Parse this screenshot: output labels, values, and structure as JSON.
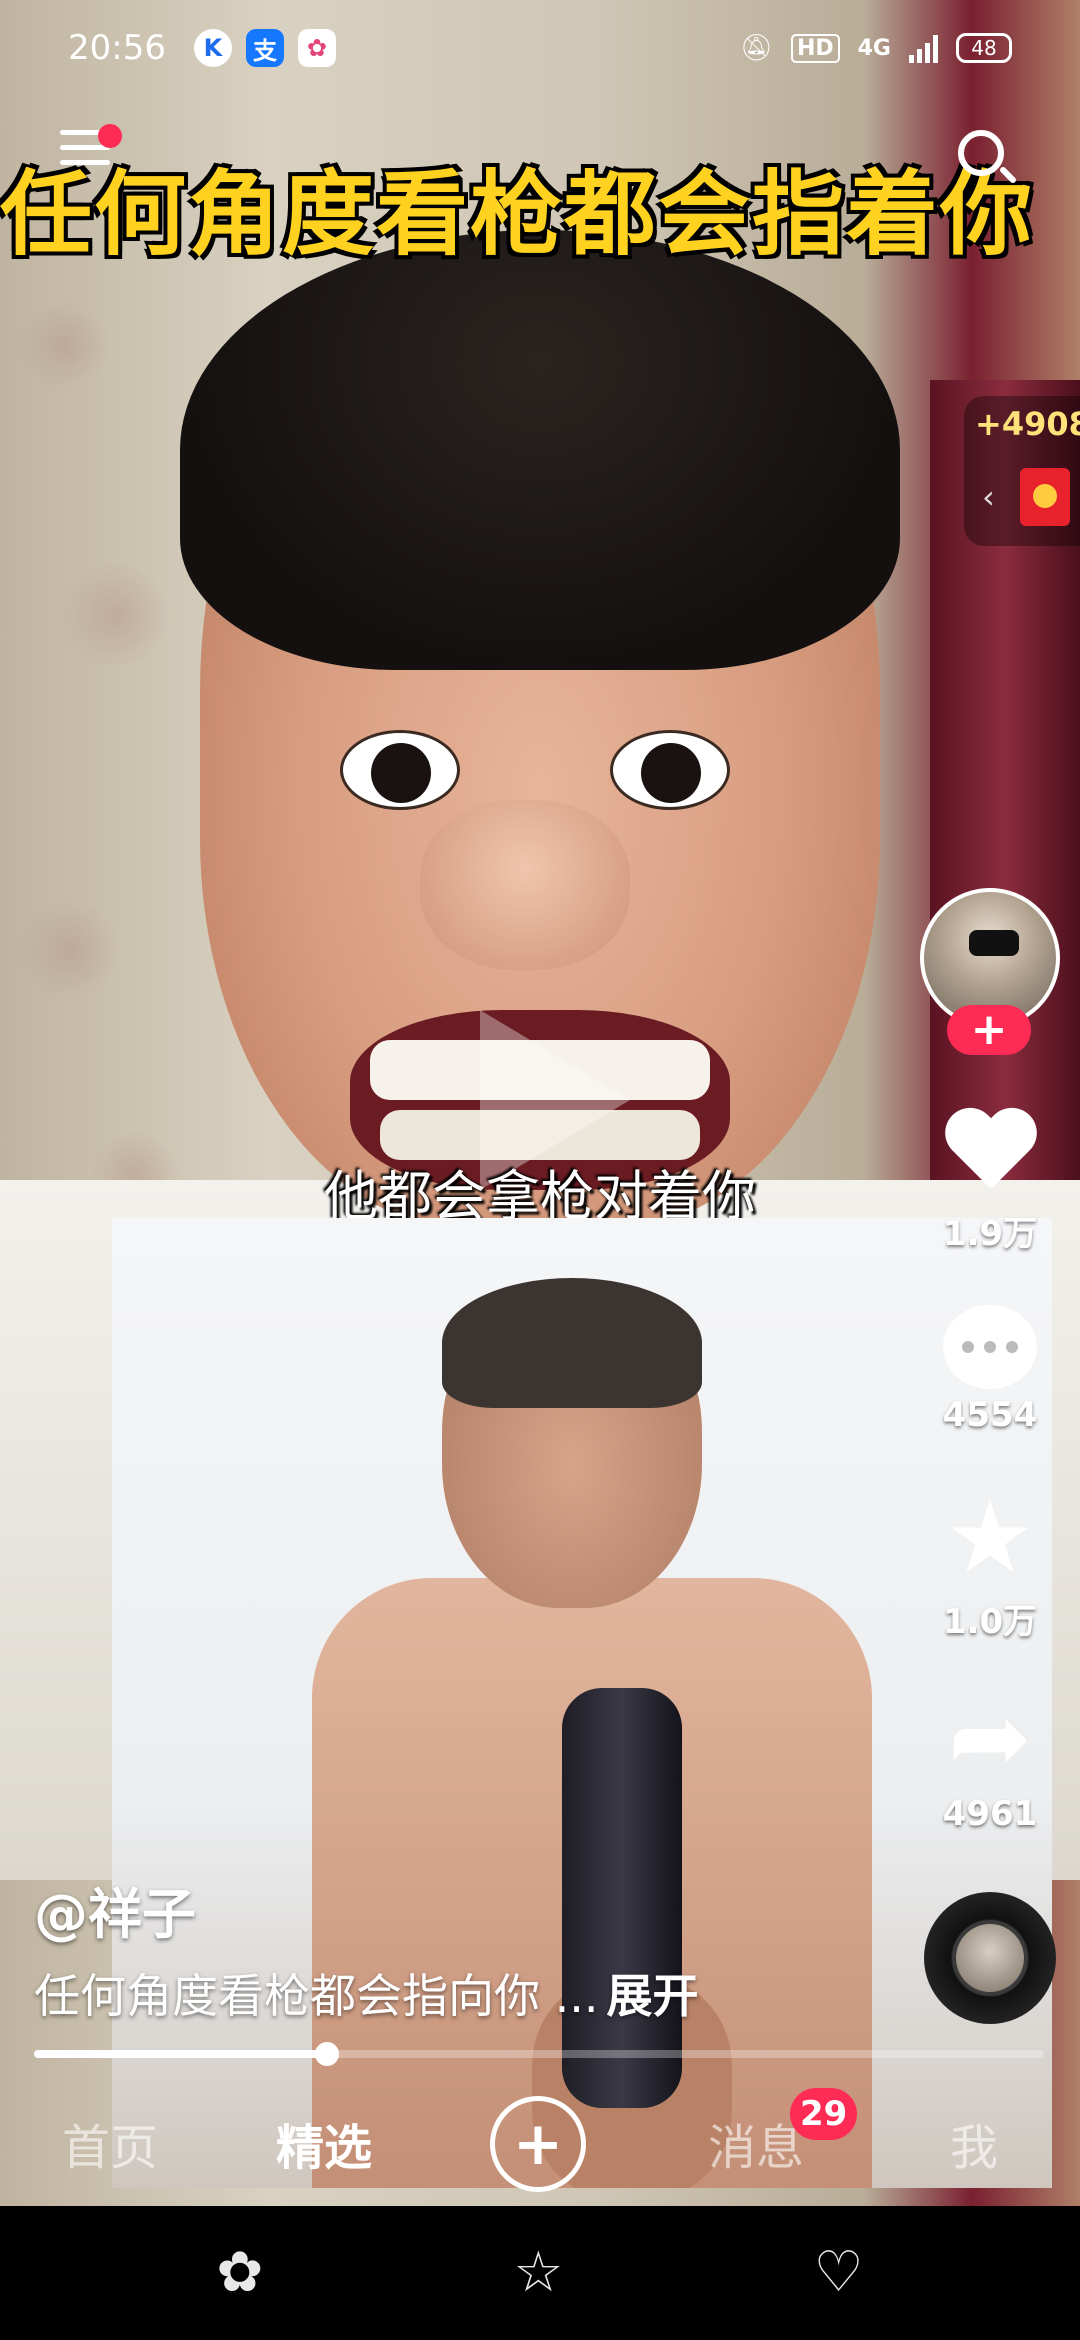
{
  "status_bar": {
    "time": "20:56",
    "apps": [
      {
        "icon": "k-app-icon",
        "glyph": "K",
        "color": "#1e6cf0"
      },
      {
        "icon": "alipay-icon",
        "glyph": "支",
        "color": "#1677ff"
      },
      {
        "icon": "palette-app-icon",
        "glyph": "✿",
        "color": "#ffffff"
      }
    ],
    "hd": "HD",
    "network": "4G",
    "battery": "48"
  },
  "video": {
    "top_banner": "任何角度看枪都会指着你",
    "subtitle": "他都会拿枪对着你"
  },
  "reward": {
    "count": "+4908",
    "chevron": "‹"
  },
  "actions": {
    "follow": "+",
    "likes": "1.9万",
    "comments": "4554",
    "favorites": "1.0万",
    "shares": "4961"
  },
  "caption": {
    "author": "@祥子",
    "description": "任何角度看枪都会指向你 ...",
    "expand": "展开"
  },
  "playback": {
    "progress": 0.29
  },
  "tabbar": {
    "home": "首页",
    "featured": "精选",
    "create": "+",
    "messages": "消息",
    "messages_badge": "29",
    "me": "我"
  },
  "colors": {
    "accent": "#fe2c55",
    "banner_text": "#ffd21f"
  },
  "system_nav": {
    "left": "✿",
    "center": "☆",
    "right": "♡"
  }
}
